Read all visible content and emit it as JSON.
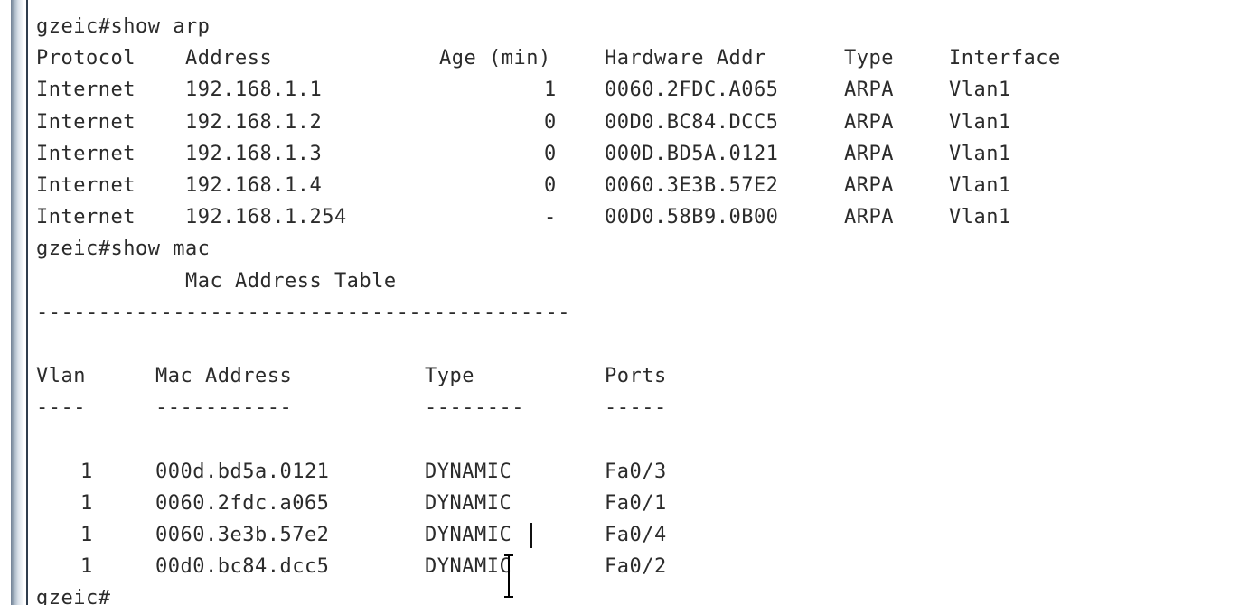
{
  "terminal": {
    "cmd_arp": "gzeic#show arp",
    "arp_header": {
      "protocol": "Protocol",
      "address": "Address",
      "age": "Age (min)",
      "hw": "Hardware Addr",
      "type": "Type",
      "interface": "Interface"
    },
    "arp_rows": [
      {
        "protocol": "Internet",
        "address": "192.168.1.1",
        "age": "1",
        "hw": "0060.2FDC.A065",
        "type": "ARPA",
        "interface": "Vlan1"
      },
      {
        "protocol": "Internet",
        "address": "192.168.1.2",
        "age": "0",
        "hw": "00D0.BC84.DCC5",
        "type": "ARPA",
        "interface": "Vlan1"
      },
      {
        "protocol": "Internet",
        "address": "192.168.1.3",
        "age": "0",
        "hw": "000D.BD5A.0121",
        "type": "ARPA",
        "interface": "Vlan1"
      },
      {
        "protocol": "Internet",
        "address": "192.168.1.4",
        "age": "0",
        "hw": "0060.3E3B.57E2",
        "type": "ARPA",
        "interface": "Vlan1"
      },
      {
        "protocol": "Internet",
        "address": "192.168.1.254",
        "age": "-",
        "hw": "00D0.58B9.0B00",
        "type": "ARPA",
        "interface": "Vlan1"
      }
    ],
    "cmd_mac": "gzeic#show mac",
    "mac_title": "Mac Address Table",
    "mac_rule": "-------------------------------------------",
    "mac_header": {
      "vlan": "Vlan",
      "mac": "Mac Address",
      "type": "Type",
      "ports": "Ports"
    },
    "mac_header_rule": {
      "vlan": "----",
      "mac": "-----------",
      "type": "--------",
      "ports": "-----"
    },
    "mac_rows": [
      {
        "vlan": "1",
        "mac": "000d.bd5a.0121",
        "type": "DYNAMIC",
        "port": "Fa0/3"
      },
      {
        "vlan": "1",
        "mac": "0060.2fdc.a065",
        "type": "DYNAMIC",
        "port": "Fa0/1"
      },
      {
        "vlan": "1",
        "mac": "0060.3e3b.57e2",
        "type": "DYNAMIC",
        "port": "Fa0/4"
      },
      {
        "vlan": "1",
        "mac": "00d0.bc84.dcc5",
        "type": "DYNAMIC",
        "port": "Fa0/2"
      }
    ],
    "prompt": "gzeic#"
  }
}
